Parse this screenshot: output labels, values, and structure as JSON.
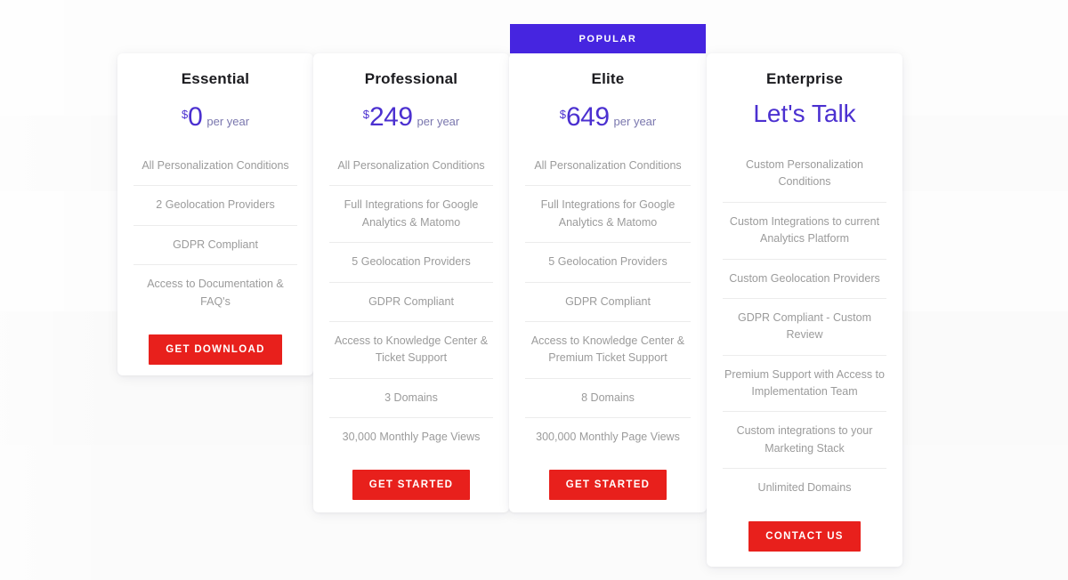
{
  "badge": {
    "label": "POPULAR"
  },
  "currency_symbol": "$",
  "period_label": "per year",
  "plans": [
    {
      "name": "Essential",
      "price": "0",
      "currency": "$",
      "period": "per year",
      "features": [
        "All Personalization Conditions",
        "2 Geolocation Providers",
        "GDPR Compliant",
        "Access to Documentation & FAQ's"
      ],
      "cta": "GET DOWNLOAD",
      "popular": false
    },
    {
      "name": "Professional",
      "price": "249",
      "currency": "$",
      "period": "per year",
      "features": [
        "All Personalization Conditions",
        "Full Integrations for Google Analytics & Matomo",
        "5 Geolocation Providers",
        "GDPR Compliant",
        "Access to Knowledge Center & Ticket Support",
        "3 Domains",
        "30,000 Monthly Page Views"
      ],
      "cta": "GET STARTED",
      "popular": false
    },
    {
      "name": "Elite",
      "price": "649",
      "currency": "$",
      "period": "per year",
      "features": [
        "All Personalization Conditions",
        "Full Integrations for Google Analytics & Matomo",
        "5 Geolocation Providers",
        "GDPR Compliant",
        "Access to Knowledge Center & Premium Ticket Support",
        "8 Domains",
        "300,000 Monthly Page Views"
      ],
      "cta": "GET STARTED",
      "popular": true
    },
    {
      "name": "Enterprise",
      "price_text": "Let's Talk",
      "features": [
        "Custom Personalization Conditions",
        "Custom Integrations to current Analytics Platform",
        "Custom Geolocation Providers",
        "GDPR Compliant - Custom Review",
        "Premium Support with Access to Implementation Team",
        "Custom integrations to your Marketing Stack",
        "Unlimited Domains"
      ],
      "cta": "CONTACT US",
      "popular": false
    }
  ],
  "colors": {
    "accent_purple": "#4b30d0",
    "badge_purple": "#4625e0",
    "cta_red": "#e8201c",
    "card_bg": "#ffffff",
    "page_bg": "#fafafa",
    "feature_text": "#9b9b9b",
    "plan_name": "#1b1b1f"
  }
}
